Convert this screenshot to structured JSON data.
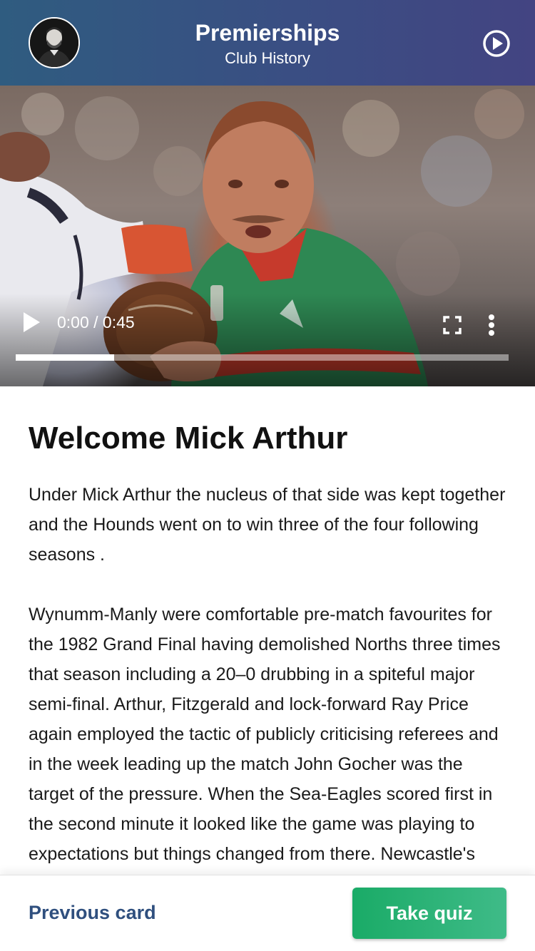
{
  "header": {
    "title": "Premierships",
    "subtitle": "Club History"
  },
  "video": {
    "time_display": "0:00 / 0:45",
    "progress": 0.2
  },
  "article": {
    "title": "Welcome Mick Arthur",
    "paragraphs": [
      "Under Mick Arthur the nucleus of that side was kept together and the Hounds went on to win three of the four following seasons .",
      "Wynumm-Manly were comfortable pre-match favourites for the 1982 Grand Final having demolished Norths three times that season including a 20–0 drubbing in a spiteful major semi-final. Arthur, Fitzgerald and lock-forward Ray Price again employed the tactic of publicly criticising referees and in the week leading up the match John Gocher was the target of the pressure. When the Sea-Eagles scored first in the second minute it looked like the game was playing to expectations but things changed from there. Newcastle's forwards ruled supreme to dominate"
    ]
  },
  "footer": {
    "previous_label": "Previous card",
    "quiz_label": "Take quiz"
  },
  "colors": {
    "header_start": "#2f5c80",
    "header_end": "#434482",
    "link": "#2f4f7e",
    "cta": "#1aab67"
  },
  "icons": {
    "header_right": "play-circle-icon",
    "video_play": "play-icon",
    "video_fullscreen": "fullscreen-icon",
    "video_more": "more-vertical-icon"
  }
}
